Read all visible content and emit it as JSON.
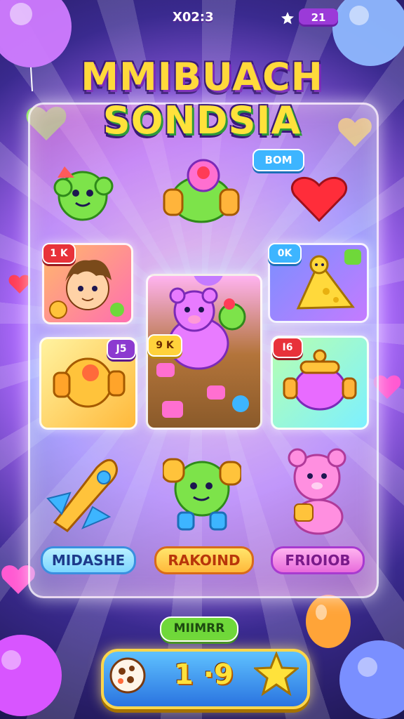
{
  "hud": {
    "code": "X02:3",
    "score": "21"
  },
  "title": {
    "line1": "MMIBUACH",
    "line2": "SONDSIA"
  },
  "board": {
    "top_tag": "BOM",
    "cards": [
      {
        "id": "hero-card",
        "tag": "1 K"
      },
      {
        "id": "pig-card",
        "tag": "9 K"
      },
      {
        "id": "cheese-card",
        "tag": "0K"
      },
      {
        "id": "cannon-left-card",
        "tag": "J5"
      },
      {
        "id": "pot-card",
        "tag": "I6"
      }
    ],
    "labels": [
      "MIDASHE",
      "RAKOIND",
      "FRIOIOB"
    ]
  },
  "footer": {
    "pill": "MIIMRR",
    "counter": "1 ·9"
  },
  "colors": {
    "accent_yellow": "#ffd93b",
    "accent_purple": "#8c3ad0",
    "accent_blue": "#3db5ff",
    "accent_green": "#6fd83a"
  }
}
